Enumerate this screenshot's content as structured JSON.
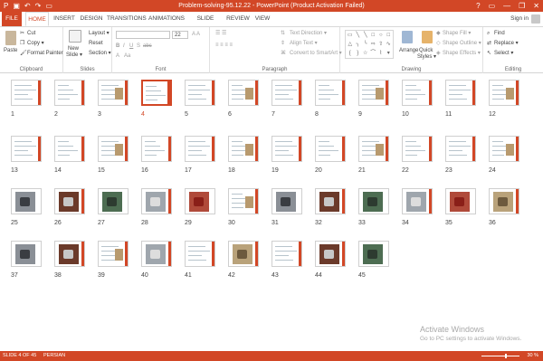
{
  "window": {
    "title": "Problem-solving-95.12.22 - PowerPoint (Product Activation Failed)",
    "qat_icons": [
      "save-icon",
      "undo-icon",
      "redo-icon",
      "start-presentation-icon"
    ],
    "controls": [
      "?",
      "▭",
      "—",
      "❐",
      "✕"
    ]
  },
  "tabs": {
    "file": "FILE",
    "home": "HOME",
    "insert": "INSERT",
    "design": "DESIGN",
    "transitions": "TRANSITIONS",
    "animations": "ANIMATIONS",
    "slideshow": "SLIDE SHOW",
    "review": "REVIEW",
    "view": "VIEW",
    "active": "HOME"
  },
  "account": {
    "signin": "Sign in"
  },
  "ribbon": {
    "clipboard": {
      "paste": "Paste",
      "cut": "Cut",
      "copy": "Copy ▾",
      "format_painter": "Format Painter",
      "label": "Clipboard"
    },
    "slides": {
      "new_slide_1": "New",
      "new_slide_2": "Slide ▾",
      "layout": "Layout ▾",
      "reset": "Reset",
      "section": "Section ▾",
      "label": "Slides"
    },
    "font": {
      "font_size": "22",
      "label": "Font"
    },
    "paragraph": {
      "text_direction": "Text Direction ▾",
      "align_text": "Align Text ▾",
      "convert_smartart": "Convert to SmartArt ▾",
      "label": "Paragraph"
    },
    "drawing": {
      "arrange": "Arrange",
      "quick_styles_1": "Quick",
      "quick_styles_2": "Styles ▾",
      "shape_fill": "Shape Fill ▾",
      "shape_outline": "Shape Outline ▾",
      "shape_effects": "Shape Effects ▾",
      "label": "Drawing"
    },
    "editing": {
      "find": "Find",
      "replace": "Replace ▾",
      "select": "Select ▾",
      "label": "Editing"
    }
  },
  "slides": {
    "selected": "4",
    "numbers": [
      "1",
      "2",
      "3",
      "4",
      "5",
      "6",
      "7",
      "8",
      "9",
      "10",
      "11",
      "12",
      "13",
      "14",
      "15",
      "16",
      "17",
      "18",
      "19",
      "20",
      "21",
      "22",
      "23",
      "24",
      "25",
      "26",
      "27",
      "28",
      "29",
      "30",
      "31",
      "32",
      "33",
      "34",
      "35",
      "36",
      "37",
      "38",
      "39",
      "40",
      "41",
      "42",
      "43",
      "44",
      "45"
    ]
  },
  "watermark": {
    "line1": "Activate Windows",
    "line2": "Go to PC settings to activate Windows."
  },
  "status": {
    "slide_of": "SLIDE 4 OF 45",
    "language": "PERSIAN",
    "zoom": "30 %"
  }
}
